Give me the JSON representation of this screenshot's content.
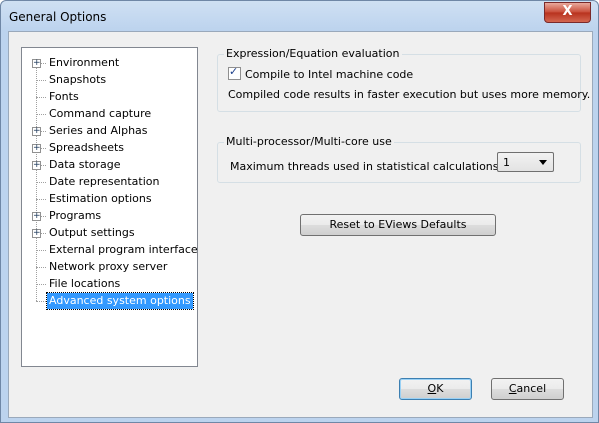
{
  "window": {
    "title": "General Options",
    "close_label": "X"
  },
  "tree": {
    "items": [
      {
        "label": "Environment",
        "expandable": true
      },
      {
        "label": "Snapshots",
        "expandable": false
      },
      {
        "label": "Fonts",
        "expandable": false
      },
      {
        "label": "Command capture",
        "expandable": false
      },
      {
        "label": "Series and Alphas",
        "expandable": true
      },
      {
        "label": "Spreadsheets",
        "expandable": true
      },
      {
        "label": "Data storage",
        "expandable": true
      },
      {
        "label": "Date representation",
        "expandable": false
      },
      {
        "label": "Estimation options",
        "expandable": false
      },
      {
        "label": "Programs",
        "expandable": true
      },
      {
        "label": "Output settings",
        "expandable": true
      },
      {
        "label": "External program interface",
        "expandable": false
      },
      {
        "label": "Network proxy server",
        "expandable": false
      },
      {
        "label": "File locations",
        "expandable": false
      },
      {
        "label": "Advanced system options",
        "expandable": false,
        "selected": true
      }
    ]
  },
  "expression_group": {
    "title": "Expression/Equation evaluation",
    "compile_label": "Compile to Intel machine code",
    "compile_checked": true,
    "note": "Compiled code results in faster execution but uses more memory."
  },
  "multiproc_group": {
    "title": "Multi-processor/Multi-core use",
    "threads_label": "Maximum threads used in statistical calculations:",
    "threads_value": "1"
  },
  "buttons": {
    "reset": "Reset to EViews Defaults",
    "ok_mnemonic": "O",
    "ok_rest": "K",
    "cancel_mnemonic": "C",
    "cancel_rest": "ancel"
  }
}
